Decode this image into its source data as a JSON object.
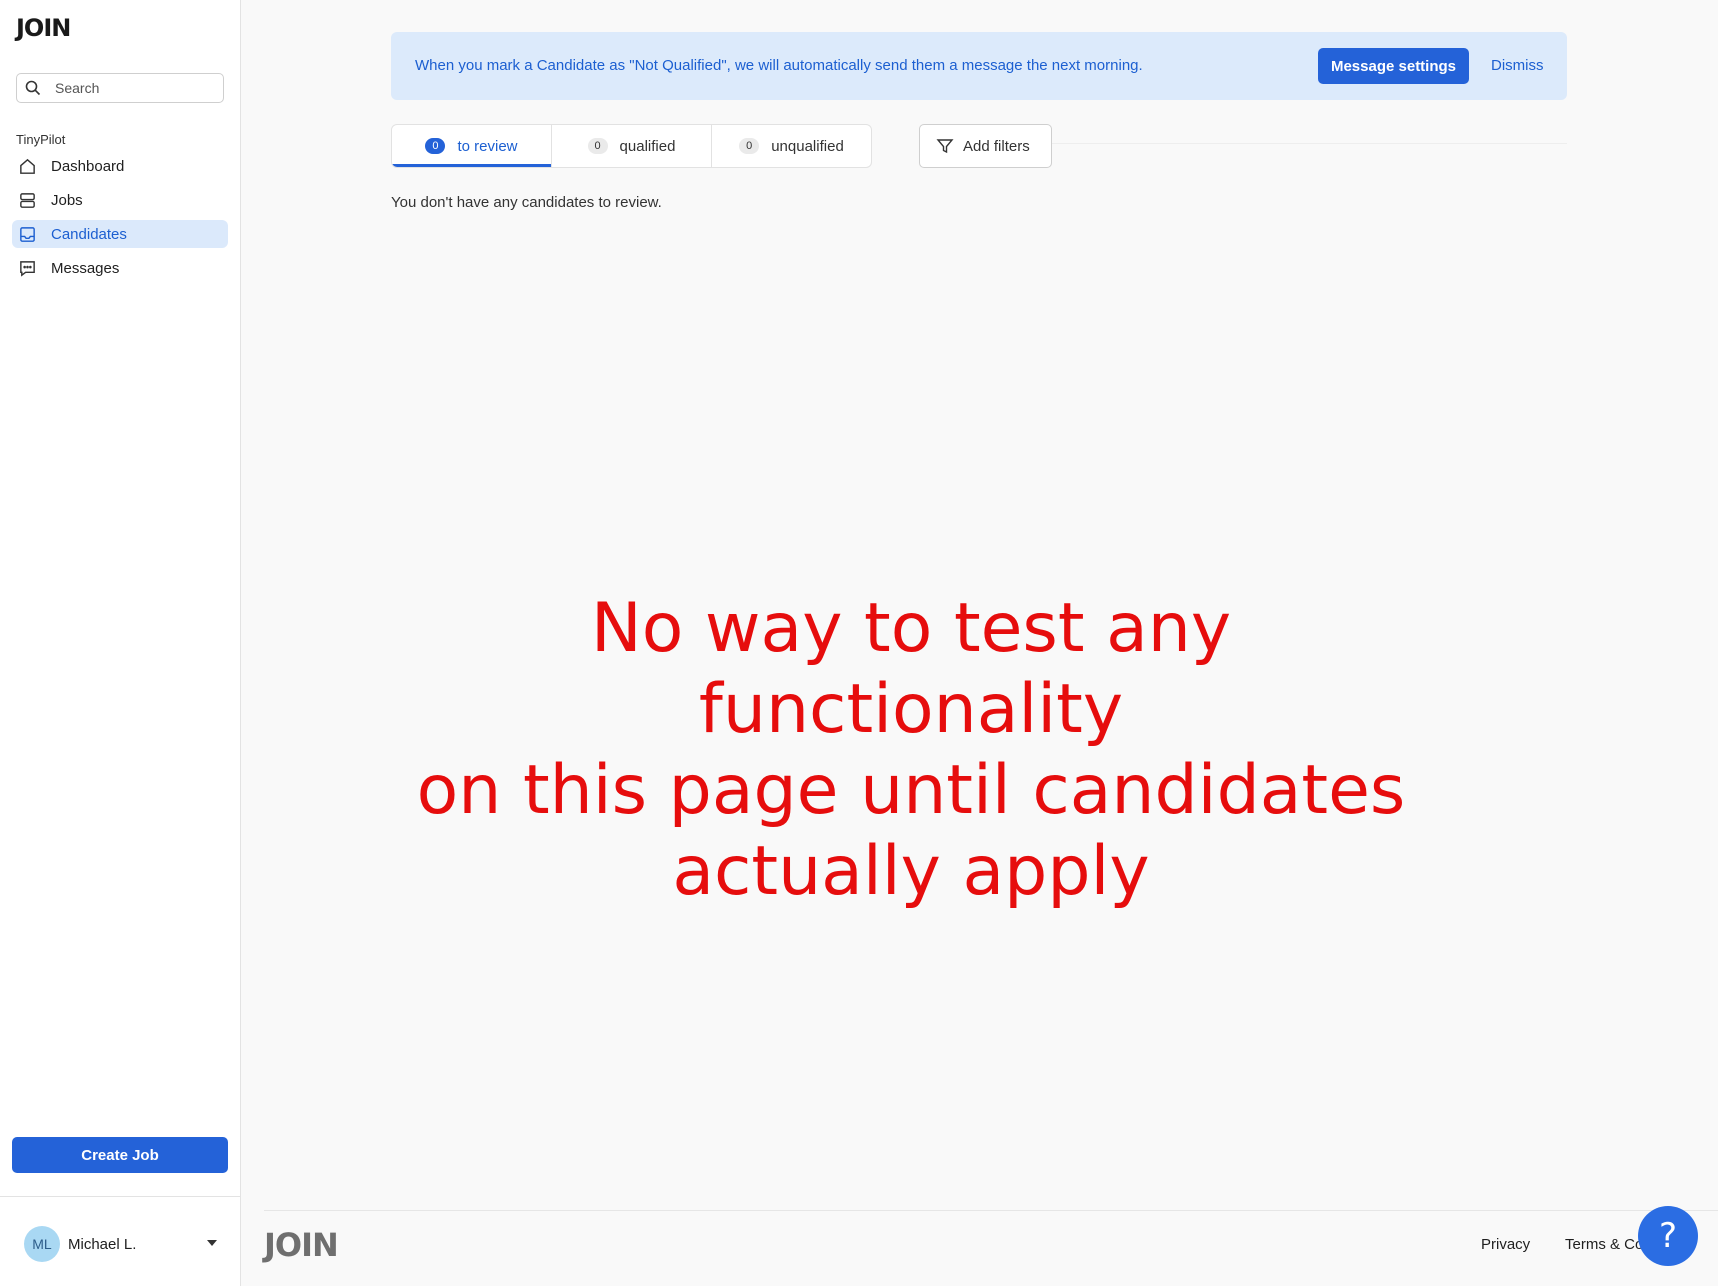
{
  "app": {
    "logo_text": "JOIN"
  },
  "sidebar": {
    "search_placeholder": "Search",
    "org_name": "TinyPilot",
    "items": [
      {
        "label": "Dashboard",
        "icon": "home-icon",
        "active": false
      },
      {
        "label": "Jobs",
        "icon": "jobs-icon",
        "active": false
      },
      {
        "label": "Candidates",
        "icon": "inbox-icon",
        "active": true
      },
      {
        "label": "Messages",
        "icon": "messages-icon",
        "active": false
      }
    ],
    "create_job_label": "Create Job",
    "user": {
      "initials": "ML",
      "name": "Michael L."
    }
  },
  "banner": {
    "text": "When you mark a Candidate as \"Not Qualified\", we will automatically send them a message the next morning.",
    "settings_label": "Message settings",
    "dismiss_label": "Dismiss"
  },
  "tabs": [
    {
      "count": "0",
      "label": "to review",
      "active": true
    },
    {
      "count": "0",
      "label": "qualified",
      "active": false
    },
    {
      "count": "0",
      "label": "unqualified",
      "active": false
    }
  ],
  "filters_label": "Add filters",
  "empty_message": "You don't have any candidates to review.",
  "annotation": {
    "lines": [
      "No way to test any functionality",
      "on this page until candidates",
      "actually apply"
    ],
    "color": "#e60d0d"
  },
  "footer": {
    "logo_text": "JOIN",
    "privacy_label": "Privacy",
    "terms_label": "Terms & Co",
    "help_label": "?"
  },
  "colors": {
    "accent": "#2462d8",
    "banner_bg": "#dceafb",
    "active_nav_bg": "#dbe9fb"
  }
}
